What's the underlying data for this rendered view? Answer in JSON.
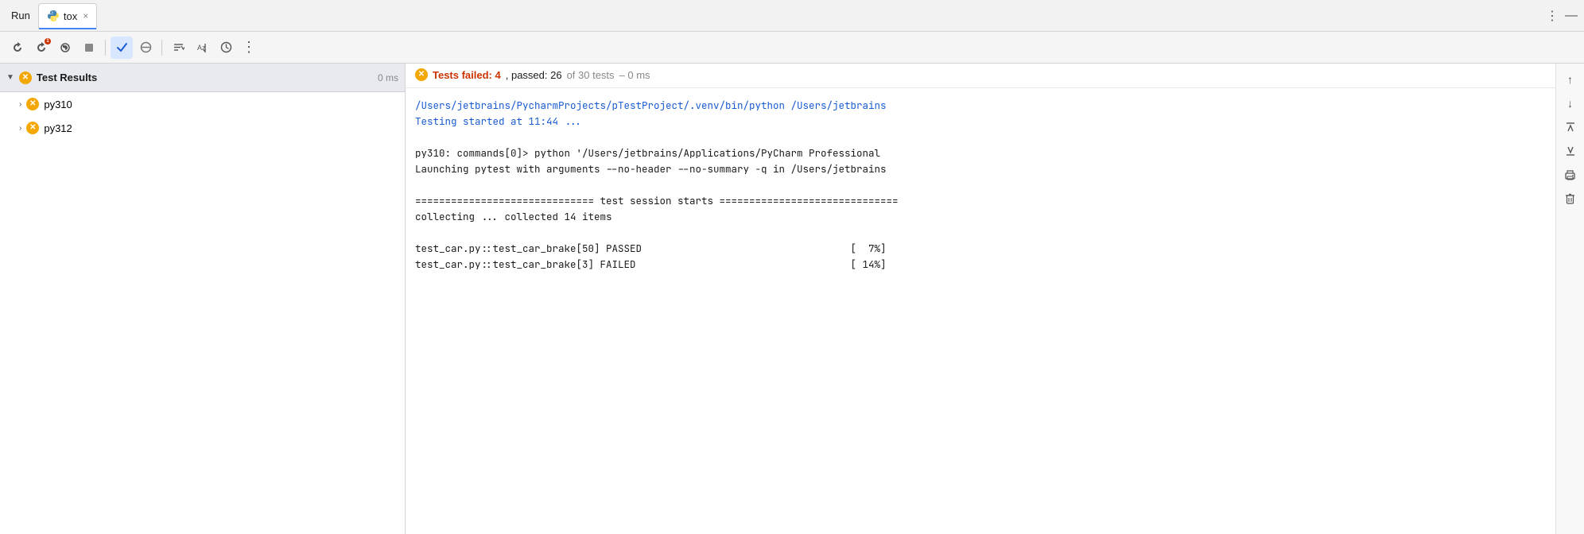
{
  "titlebar": {
    "run_label": "Run",
    "tab_label": "tox",
    "tab_close": "×",
    "more_icon": "⋮",
    "minimize_icon": "—"
  },
  "toolbar": {
    "buttons": [
      {
        "name": "rerun-button",
        "icon": "↻",
        "title": "Rerun"
      },
      {
        "name": "rerun-failed-button",
        "icon": "↻₁",
        "title": "Rerun failed tests"
      },
      {
        "name": "run-coverage-button",
        "icon": "⟳",
        "title": "Run with coverage"
      },
      {
        "name": "stop-button",
        "icon": "■",
        "title": "Stop"
      },
      {
        "name": "filter-passed-button",
        "icon": "✓",
        "title": "Show passed",
        "active": true
      },
      {
        "name": "filter-ignored-button",
        "icon": "⊘",
        "title": "Show ignored"
      }
    ],
    "sort_buttons": [
      {
        "name": "sort-button",
        "icon": "↕",
        "title": "Sort"
      },
      {
        "name": "sort-alpha-button",
        "icon": "↙",
        "title": "Sort alphabetically"
      },
      {
        "name": "history-button",
        "icon": "⏱",
        "title": "History"
      }
    ],
    "more_label": "⋮"
  },
  "left_panel": {
    "header": {
      "label": "Test Results",
      "time": "0 ms"
    },
    "items": [
      {
        "id": "py310",
        "label": "py310",
        "status": "error"
      },
      {
        "id": "py312",
        "label": "py312",
        "status": "error"
      }
    ]
  },
  "right_panel": {
    "status": {
      "icon": "error",
      "failed_label": "Tests failed: 4",
      "passed_label": ", passed: 26",
      "total_label": " of 30 tests",
      "time_label": "– 0 ms"
    },
    "output_lines": [
      {
        "text": "/Users/jetbrains/PycharmProjects/pTestProject/.venv/bin/python /Users/jetbrains",
        "style": "blue"
      },
      {
        "text": "Testing started at 11:44 ...",
        "style": "blue"
      },
      {
        "text": "",
        "style": "normal"
      },
      {
        "text": "py310: commands[0]> python '/Users/jetbrains/Applications/PyCharm Professional",
        "style": "normal"
      },
      {
        "text": "Launching pytest with arguments --no-header --no-summary -q in /Users/jetbrains",
        "style": "normal"
      },
      {
        "text": "",
        "style": "normal"
      },
      {
        "text": "============================== test session starts ==============================",
        "style": "normal"
      },
      {
        "text": "collecting ... collected 14 items",
        "style": "normal"
      },
      {
        "text": "",
        "style": "normal"
      },
      {
        "text": "test_car.py::test_car_brake[50] PASSED                                   [  7%]",
        "style": "normal"
      },
      {
        "text": "test_car.py::test_car_brake[3] FAILED                                    [ 14%]",
        "style": "normal"
      }
    ]
  },
  "side_actions": {
    "buttons": [
      {
        "name": "scroll-up-button",
        "icon": "↑"
      },
      {
        "name": "scroll-down-button",
        "icon": "↓"
      },
      {
        "name": "scroll-to-top-button",
        "icon": "⤒"
      },
      {
        "name": "scroll-to-bottom-button",
        "icon": "⤓"
      },
      {
        "name": "print-button",
        "icon": "🖨"
      },
      {
        "name": "delete-button",
        "icon": "🗑"
      }
    ]
  }
}
